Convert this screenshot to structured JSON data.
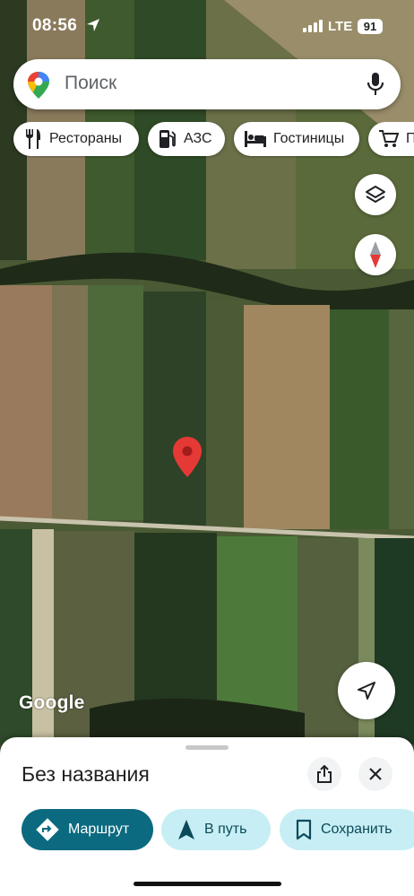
{
  "status_bar": {
    "time": "08:56",
    "network": "LTE",
    "battery": "91"
  },
  "search": {
    "placeholder": "Поиск"
  },
  "chips": [
    {
      "label": "Рестораны",
      "icon": "restaurant-icon"
    },
    {
      "label": "АЗС",
      "icon": "gas-station-icon"
    },
    {
      "label": "Гостиницы",
      "icon": "hotel-icon"
    },
    {
      "label": "П",
      "icon": "shopping-cart-icon"
    }
  ],
  "map": {
    "attribution": "Google",
    "type": "satellite"
  },
  "colors": {
    "accent": "#0b6a80",
    "accent_light": "#c7eef5",
    "marker": "#e53935"
  },
  "place": {
    "title": "Без названия",
    "actions": [
      {
        "label": "Маршрут",
        "icon": "directions-icon"
      },
      {
        "label": "В путь",
        "icon": "navigation-arrow-icon"
      },
      {
        "label": "Сохранить",
        "icon": "bookmark-icon"
      }
    ]
  }
}
